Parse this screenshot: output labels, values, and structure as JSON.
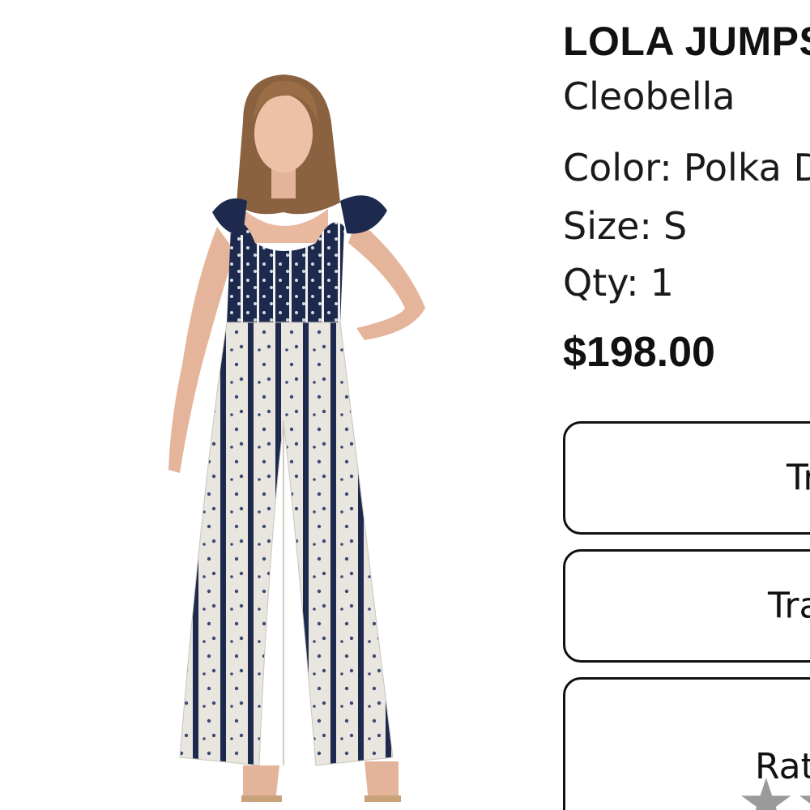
{
  "product": {
    "title": "LOLA JUMPSUIT",
    "brand": "Cleobella",
    "color_label": "Color:",
    "color_value": "Polka Dot Stripe",
    "size_label": "Size:",
    "size_value": "S",
    "qty_label": "Qty:",
    "qty_value": "1",
    "price": "$198.00",
    "image_description_icon": "product-photo"
  },
  "actions": {
    "button_1_label": "Track",
    "button_2_label": "Track",
    "button_3_label": "Rate"
  },
  "rating": {
    "value": 0,
    "max": 5,
    "icon": "star-icon"
  },
  "colors": {
    "text": "#111111",
    "border": "#111111",
    "star": "#9a9a9a",
    "navy": "#1d2a4d"
  }
}
